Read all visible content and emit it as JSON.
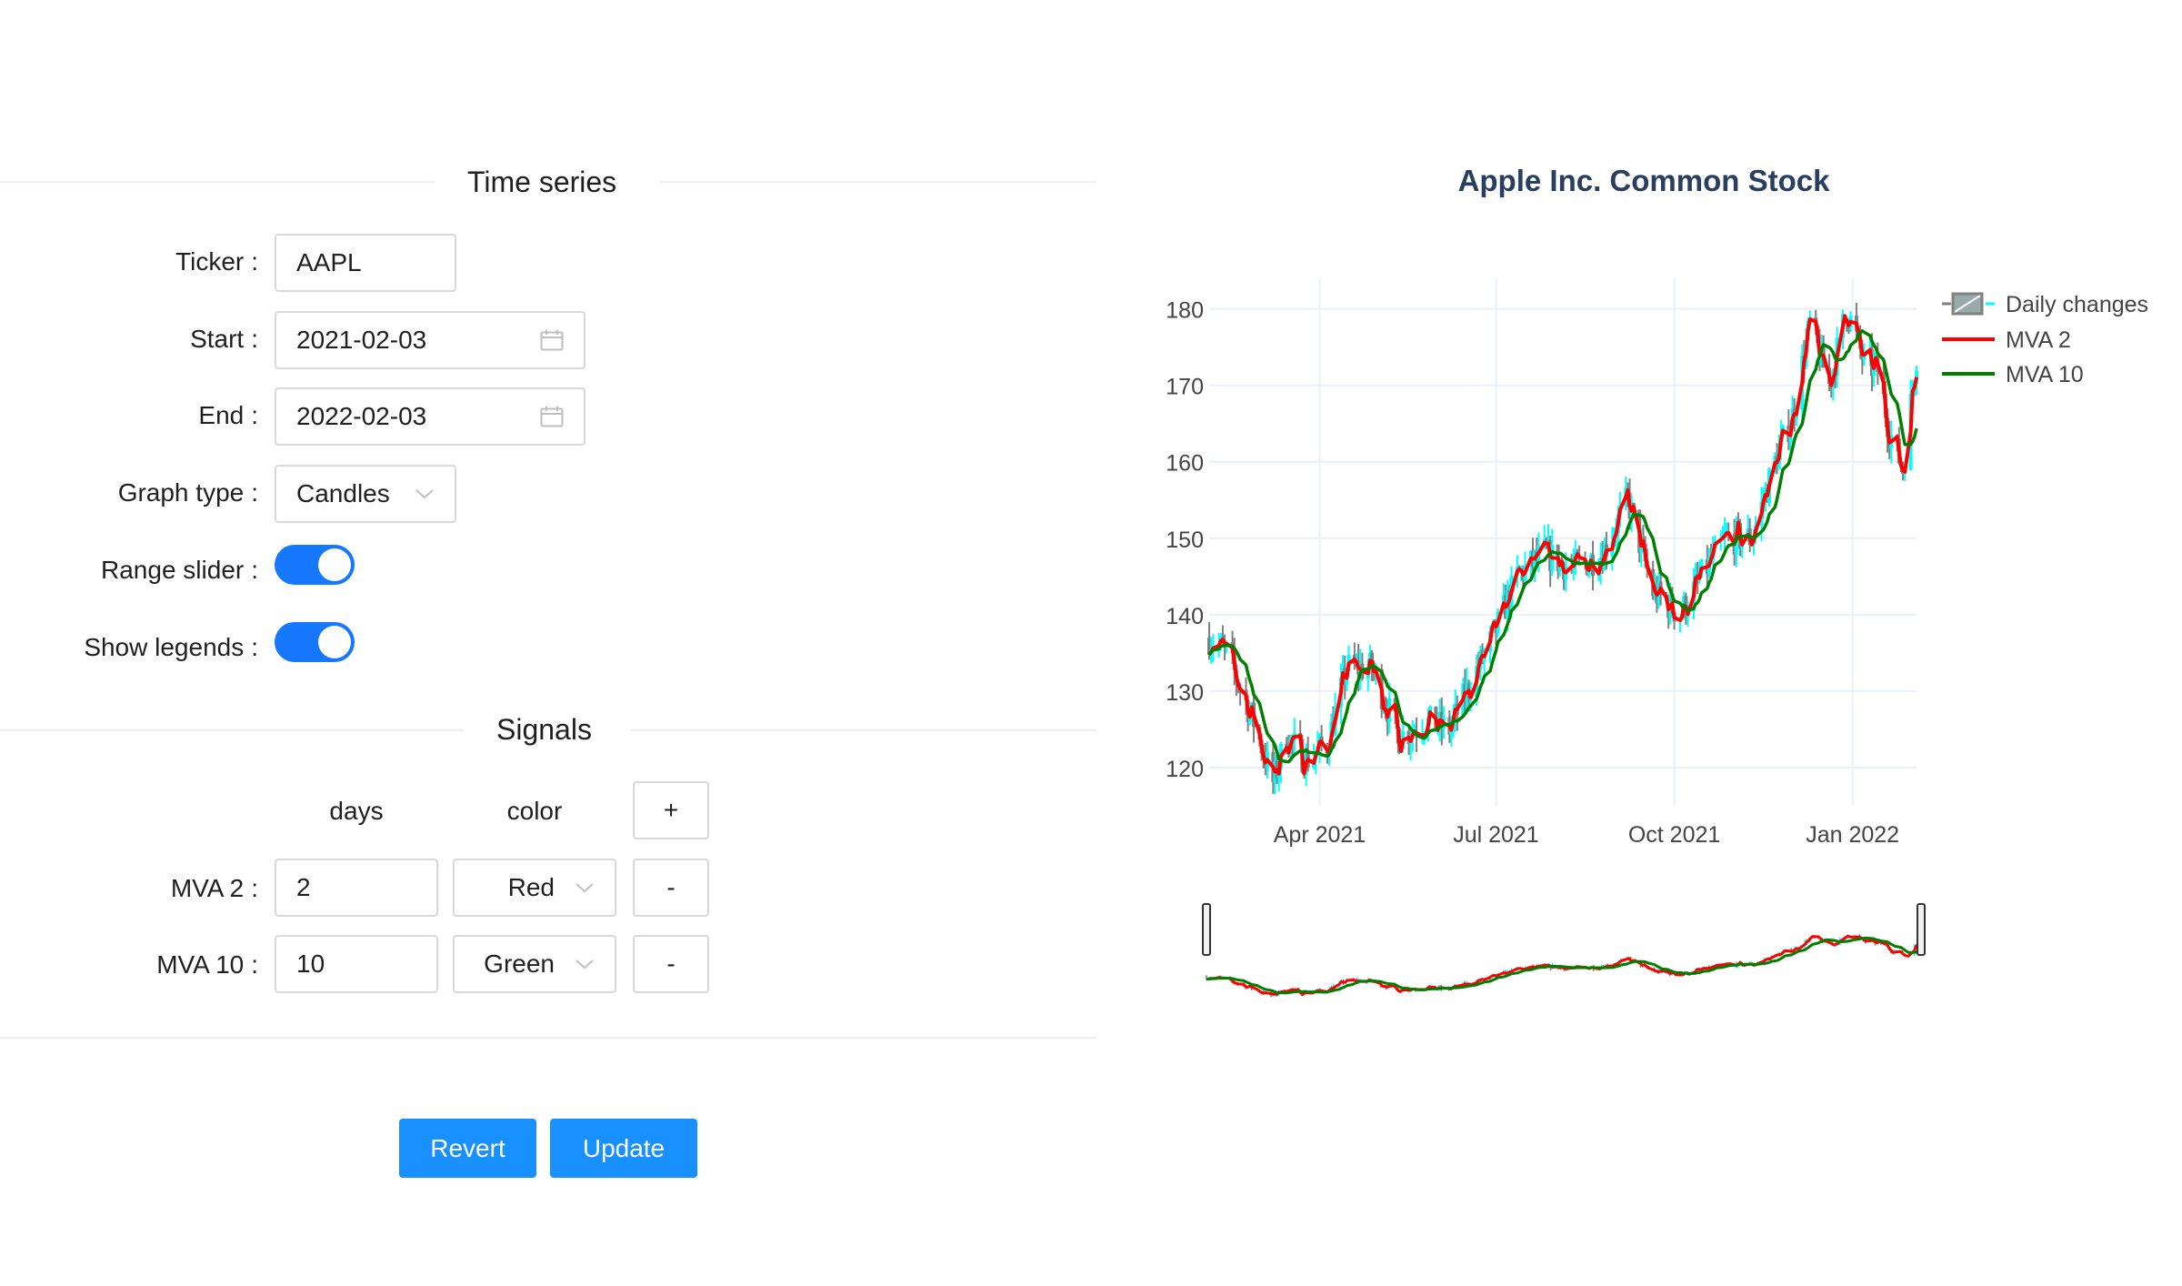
{
  "form": {
    "time_series_title": "Time series",
    "signals_title": "Signals",
    "ticker_label": "Ticker",
    "ticker_value": "AAPL",
    "start_label": "Start",
    "start_value": "2021-02-03",
    "end_label": "End",
    "end_value": "2022-02-03",
    "graph_type_label": "Graph type",
    "graph_type_value": "Candles",
    "range_slider_label": "Range slider",
    "range_slider_on": true,
    "show_legends_label": "Show legends",
    "show_legends_on": true,
    "days_header": "days",
    "color_header": "color",
    "add_label": "+",
    "signals": [
      {
        "label": "MVA 2",
        "days": "2",
        "color": "Red",
        "remove_label": "-"
      },
      {
        "label": "MVA 10",
        "days": "10",
        "color": "Green",
        "remove_label": "-"
      }
    ],
    "revert_label": "Revert",
    "update_label": "Update",
    "colon": ":"
  },
  "theme": {
    "primary": "#1890ff",
    "toggle_on": "#1677ff",
    "border": "#d9d9d9"
  },
  "chart_data": {
    "type": "candlestick",
    "title": "Apple Inc. Common Stock",
    "ylim": [
      115,
      184
    ],
    "xlim": [
      "2021-02-03",
      "2022-02-03"
    ],
    "yticks": [
      120,
      130,
      140,
      150,
      160,
      170,
      180
    ],
    "xticks": [
      {
        "date": "2021-04-01",
        "label": "Apr 2021"
      },
      {
        "date": "2021-07-01",
        "label": "Jul 2021"
      },
      {
        "date": "2021-10-01",
        "label": "Oct 2021"
      },
      {
        "date": "2022-01-01",
        "label": "Jan 2022"
      }
    ],
    "grid": true,
    "range_slider": true,
    "legend_position": "top-right",
    "series": [
      {
        "name": "Daily changes",
        "kind": "candles",
        "increasing_color": "#00ffff",
        "decreasing_color": "#808080"
      },
      {
        "name": "MVA 2",
        "kind": "line",
        "color": "#ff0000"
      },
      {
        "name": "MVA 10",
        "kind": "line",
        "color": "#008000"
      }
    ],
    "price_anchors": [
      {
        "date": "2021-02-03",
        "close": 137
      },
      {
        "date": "2021-02-12",
        "close": 135
      },
      {
        "date": "2021-02-26",
        "close": 126
      },
      {
        "date": "2021-03-08",
        "close": 118
      },
      {
        "date": "2021-03-15",
        "close": 124
      },
      {
        "date": "2021-03-25",
        "close": 121
      },
      {
        "date": "2021-04-05",
        "close": 123
      },
      {
        "date": "2021-04-15",
        "close": 133
      },
      {
        "date": "2021-04-28",
        "close": 133
      },
      {
        "date": "2021-05-12",
        "close": 124
      },
      {
        "date": "2021-05-25",
        "close": 126
      },
      {
        "date": "2021-06-07",
        "close": 125
      },
      {
        "date": "2021-06-18",
        "close": 131
      },
      {
        "date": "2021-07-01",
        "close": 138
      },
      {
        "date": "2021-07-12",
        "close": 145
      },
      {
        "date": "2021-07-26",
        "close": 148
      },
      {
        "date": "2021-08-10",
        "close": 146
      },
      {
        "date": "2021-08-25",
        "close": 148
      },
      {
        "date": "2021-09-07",
        "close": 155
      },
      {
        "date": "2021-09-20",
        "close": 143
      },
      {
        "date": "2021-10-04",
        "close": 140
      },
      {
        "date": "2021-10-15",
        "close": 145
      },
      {
        "date": "2021-10-28",
        "close": 150
      },
      {
        "date": "2021-11-10",
        "close": 150
      },
      {
        "date": "2021-11-22",
        "close": 160
      },
      {
        "date": "2021-12-01",
        "close": 166
      },
      {
        "date": "2021-12-10",
        "close": 178
      },
      {
        "date": "2021-12-20",
        "close": 170
      },
      {
        "date": "2021-12-29",
        "close": 180
      },
      {
        "date": "2022-01-07",
        "close": 173
      },
      {
        "date": "2022-01-14",
        "close": 172
      },
      {
        "date": "2022-01-20",
        "close": 164
      },
      {
        "date": "2022-01-27",
        "close": 159
      },
      {
        "date": "2022-02-03",
        "close": 174
      }
    ]
  }
}
